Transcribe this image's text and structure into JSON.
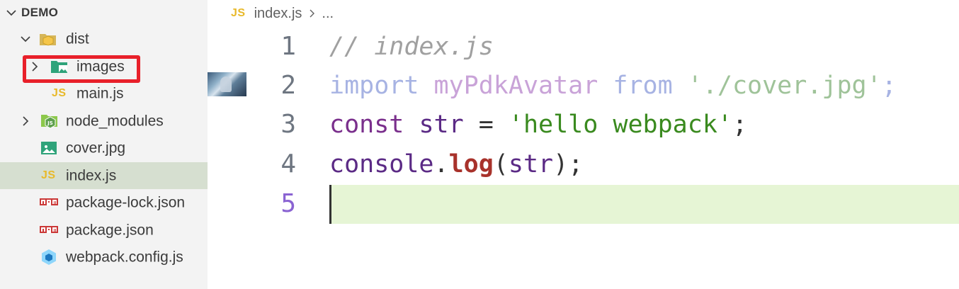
{
  "explorer": {
    "section_title": "DEMO",
    "items": [
      {
        "label": "dist",
        "type": "folder",
        "expanded": true,
        "depth": 1,
        "icon": "dist-folder-icon"
      },
      {
        "label": "images",
        "type": "folder",
        "expanded": false,
        "depth": 2,
        "icon": "images-folder-icon",
        "highlighted": true
      },
      {
        "label": "main.js",
        "type": "file",
        "depth": 2,
        "icon": "js-icon",
        "badge": "JS"
      },
      {
        "label": "node_modules",
        "type": "folder",
        "expanded": false,
        "depth": 1,
        "icon": "node-modules-folder-icon"
      },
      {
        "label": "cover.jpg",
        "type": "file",
        "depth": 1,
        "icon": "image-file-icon"
      },
      {
        "label": "index.js",
        "type": "file",
        "depth": 1,
        "icon": "js-icon",
        "badge": "JS",
        "selected": true
      },
      {
        "label": "package-lock.json",
        "type": "file",
        "depth": 1,
        "icon": "npm-icon"
      },
      {
        "label": "package.json",
        "type": "file",
        "depth": 1,
        "icon": "npm-icon"
      },
      {
        "label": "webpack.config.js",
        "type": "file",
        "depth": 1,
        "icon": "webpack-icon"
      }
    ]
  },
  "editor": {
    "breadcrumb": {
      "badge": "JS",
      "file": "index.js",
      "rest": "..."
    },
    "active_line": 5,
    "lines": [
      {
        "number": "1",
        "tokens": [
          {
            "t": "// index.js",
            "c": "comment"
          }
        ]
      },
      {
        "number": "2",
        "tokens": [
          {
            "t": "import ",
            "c": "dim"
          },
          {
            "t": "myPdkAvatar ",
            "c": "dim-id"
          },
          {
            "t": "from ",
            "c": "dim"
          },
          {
            "t": "'./cover.jpg'",
            "c": "dim-str"
          },
          {
            "t": ";",
            "c": "dim"
          }
        ]
      },
      {
        "number": "3",
        "tokens": [
          {
            "t": "const ",
            "c": "kw"
          },
          {
            "t": "str ",
            "c": "var"
          },
          {
            "t": "= ",
            "c": "op"
          },
          {
            "t": "'hello webpack'",
            "c": "str"
          },
          {
            "t": ";",
            "c": "punc"
          }
        ]
      },
      {
        "number": "4",
        "tokens": [
          {
            "t": "console",
            "c": "var"
          },
          {
            "t": ".",
            "c": "punc"
          },
          {
            "t": "log",
            "c": "fn"
          },
          {
            "t": "(",
            "c": "punc"
          },
          {
            "t": "str",
            "c": "var"
          },
          {
            "t": ")",
            "c": "punc"
          },
          {
            "t": ";",
            "c": "punc"
          }
        ]
      },
      {
        "number": "5",
        "tokens": []
      }
    ]
  },
  "colors": {
    "highlight_border": "#e8202a",
    "selected_row": "#d6dfd0",
    "current_line": "#e6f5d5",
    "js_badge": "#e8b92a"
  }
}
